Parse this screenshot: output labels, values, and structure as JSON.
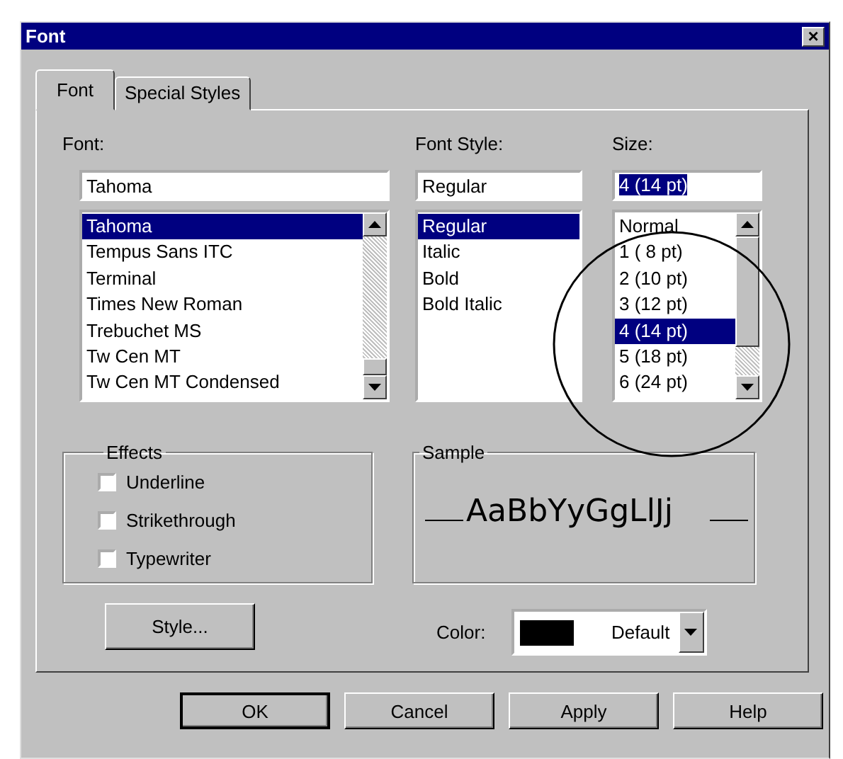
{
  "window": {
    "title": "Font",
    "close": "×"
  },
  "tabs": [
    {
      "label": "Font",
      "selected": true
    },
    {
      "label": "Special Styles",
      "selected": false
    }
  ],
  "font": {
    "label": "Font:",
    "value": "Tahoma",
    "items": [
      {
        "label": "Tahoma",
        "selected": true
      },
      {
        "label": "Tempus Sans ITC",
        "selected": false
      },
      {
        "label": "Terminal",
        "selected": false
      },
      {
        "label": "Times New Roman",
        "selected": false
      },
      {
        "label": "Trebuchet MS",
        "selected": false
      },
      {
        "label": "Tw Cen MT",
        "selected": false
      },
      {
        "label": "Tw Cen MT Condensed",
        "selected": false
      }
    ]
  },
  "font_style": {
    "label": "Font Style:",
    "value": "Regular",
    "items": [
      {
        "label": "Regular",
        "selected": true
      },
      {
        "label": "Italic",
        "selected": false
      },
      {
        "label": "Bold",
        "selected": false
      },
      {
        "label": "Bold Italic",
        "selected": false
      }
    ]
  },
  "size": {
    "label": "Size:",
    "value": "4  (14 pt)",
    "value_selected": true,
    "items": [
      {
        "label": "Normal",
        "selected": false
      },
      {
        "label": "1  (  8 pt)",
        "selected": false
      },
      {
        "label": "2  (10 pt)",
        "selected": false
      },
      {
        "label": "3  (12 pt)",
        "selected": false
      },
      {
        "label": "4  (14 pt)",
        "selected": true
      },
      {
        "label": "5  (18 pt)",
        "selected": false
      },
      {
        "label": "6  (24 pt)",
        "selected": false
      }
    ]
  },
  "effects": {
    "title": "Effects",
    "options": [
      {
        "label": "Underline",
        "checked": false
      },
      {
        "label": "Strikethrough",
        "checked": false
      },
      {
        "label": "Typewriter",
        "checked": false
      }
    ]
  },
  "sample": {
    "title": "Sample",
    "text": "AaBbYyGgLlJj"
  },
  "style_button": "Style...",
  "color": {
    "label": "Color:",
    "value": "Default"
  },
  "buttons": [
    "OK",
    "Cancel",
    "Apply",
    "Help"
  ],
  "annotation": {
    "kind": "circle"
  }
}
